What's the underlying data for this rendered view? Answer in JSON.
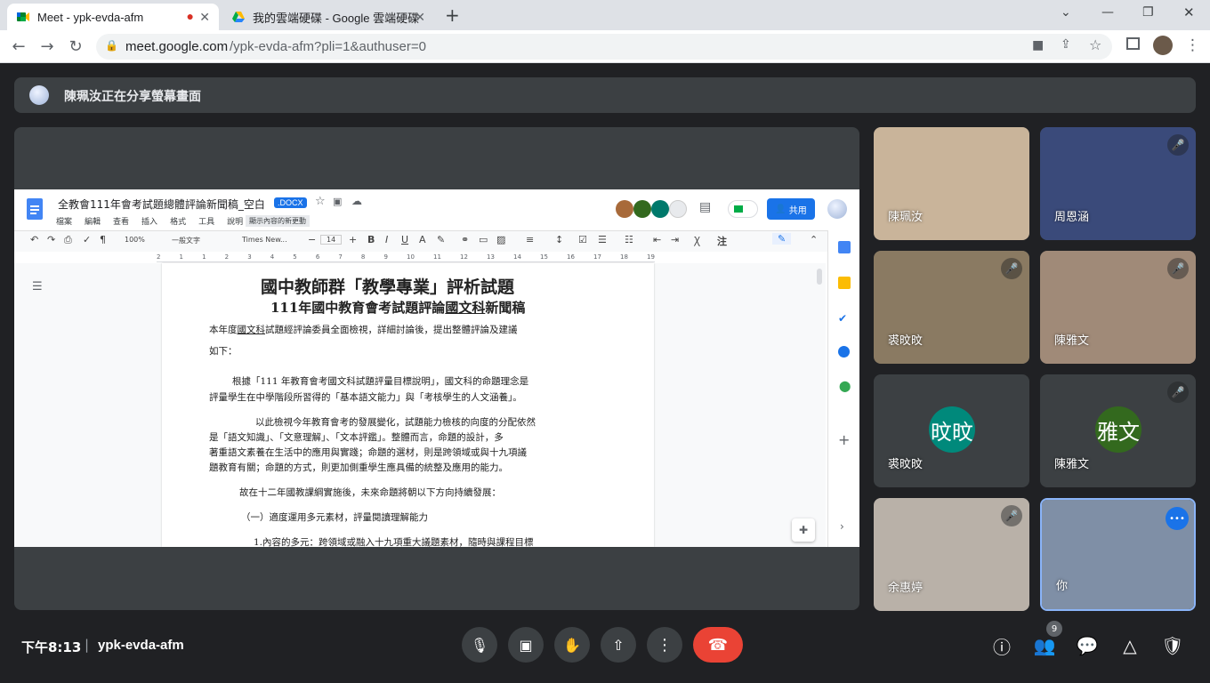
{
  "browser": {
    "tabs": [
      {
        "title": "Meet - ypk-evda-afm",
        "recording": "●",
        "close": "✕"
      },
      {
        "title": "我的雲端硬碟 - Google 雲端硬碟",
        "close": "✕"
      }
    ],
    "new_tab": "+",
    "window_controls": {
      "min": "—",
      "max": "❐",
      "close": "✕"
    },
    "url_host": "meet.google.com",
    "url_path": "/ypk-evda-afm?pli=1&authuser=0",
    "menu_dots": "⋮"
  },
  "banner": {
    "text": "陳珮汝正在分享螢幕畫面"
  },
  "doc": {
    "title": "全教會111年會考試題總體評論新聞稿_空白",
    "badge": ".DOCX",
    "menus": [
      "檔案",
      "編輯",
      "查看",
      "插入",
      "格式",
      "工具",
      "說明"
    ],
    "recent_changes": "顯示內容的新更動",
    "share_label": "共用",
    "toolbar": {
      "zoom": "100%",
      "style": "一般文字",
      "font": "Times New...",
      "size": "14"
    },
    "ruler_labels": [
      "2",
      "1",
      "1",
      "2",
      "3",
      "4",
      "5",
      "6",
      "7",
      "8",
      "9",
      "10",
      "11",
      "12",
      "13",
      "14",
      "15",
      "16",
      "17",
      "18",
      "19"
    ],
    "heading1": "國中教師群「教學專業」評析試題",
    "heading2_prefix": "111年國中教育會考試題評論",
    "heading2_ul": "國文科",
    "heading2_suffix": "新聞稿",
    "p1a_pre": "本年度",
    "p1a_ul": "國文科",
    "p1a_post": "試題經評論委員全面檢視，詳細討論後，提出整體評論及建議",
    "p1b": "如下：",
    "p2a": "根據「111 年教育會考國文科試題評量目標說明」，國文科的命題理念是",
    "p2b": "評量學生在中學階段所習得的「基本語文能力」與「考核學生的人文涵養」。",
    "p3a": "以此檢視今年教育會考的發展變化，試題能力檢核的向度的分配依然",
    "p3b": "是「語文知識」、「文意理解」、「文本評鑑」。整體而言，命題的設計，多",
    "p3c": "著重語文素養在生活中的應用與實踐；命題的選材，則是跨領域或與十九項議",
    "p3d": "題教育有關；命題的方式，則更加側重學生應具備的統整及應用的能力。",
    "p4": "故在十二年國教課綱實施後，未來命題將朝以下方向持續發展：",
    "p5": "（一）適度運用多元素材，評量閱讀理解能力",
    "p6": "1.內容的多元：跨領域或融入十九項重大議題素材，隨時與課程目標"
  },
  "participants": [
    {
      "name": "陳珮汝",
      "muted": false,
      "bg": "#c9b49a"
    },
    {
      "name": "周恩涵",
      "muted": true,
      "bg": "#3a4a7a"
    },
    {
      "name": "裘旼旼",
      "muted": true,
      "bg": "#8a7a62"
    },
    {
      "name": "陳雅文",
      "muted": true,
      "bg": "#a08a78"
    },
    {
      "name": "裘旼旼",
      "muted": false,
      "avatar": "旼旼",
      "avatar_color": "#00897b"
    },
    {
      "name": "陳雅文",
      "muted": true,
      "avatar": "雅文",
      "avatar_color": "#33691e"
    },
    {
      "name": "余惠婷",
      "muted": true,
      "bg": "#b9b1a8"
    },
    {
      "name": "你",
      "muted": false,
      "bg": "#7f8fa6",
      "more": "•••"
    }
  ],
  "bottom": {
    "time": "下午8:13",
    "separator": "|",
    "meeting_code": "ypk-evda-afm",
    "people_count": "9"
  },
  "colors": {
    "accent": "#1a73e8",
    "hangup": "#ea4335",
    "bg": "#202124",
    "tile": "#3c4043"
  },
  "icons": [
    "mic-icon",
    "camera-icon",
    "raise-hand-icon",
    "present-icon",
    "more-icon",
    "hangup-icon",
    "info-icon",
    "people-icon",
    "chat-icon",
    "activities-icon",
    "host-controls-icon"
  ]
}
